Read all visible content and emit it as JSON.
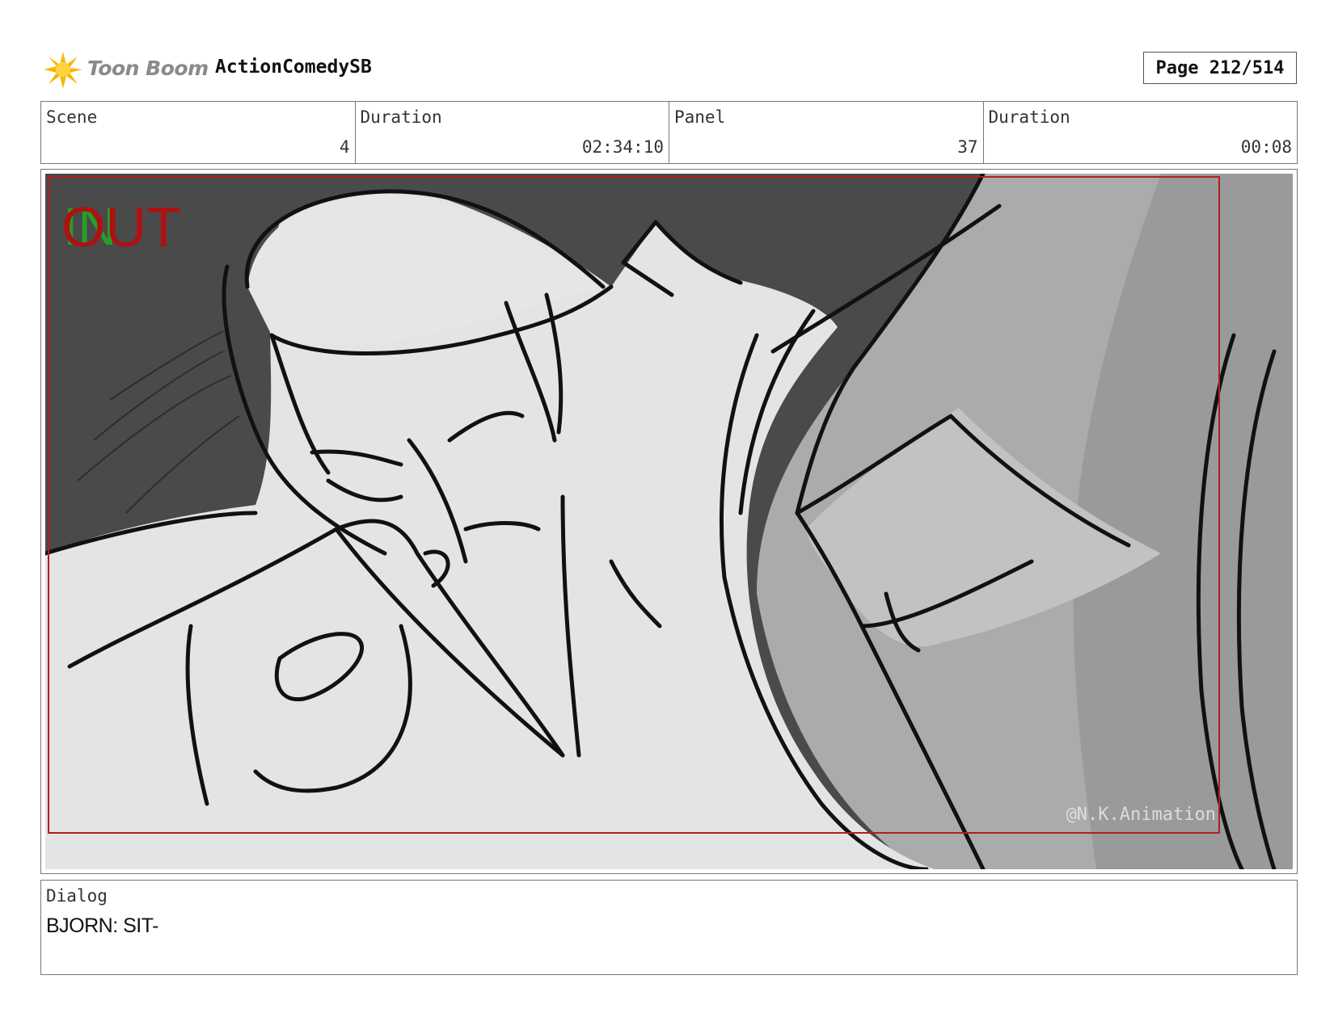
{
  "header": {
    "brand": "Toon Boom",
    "project": "ActionComedySB",
    "page": "Page 212/514"
  },
  "info": {
    "scene_label": "Scene",
    "scene_value": "4",
    "scene_duration_label": "Duration",
    "scene_duration_value": "02:34:10",
    "panel_label": "Panel",
    "panel_value": "37",
    "panel_duration_label": "Duration",
    "panel_duration_value": "00:08"
  },
  "panel": {
    "transition_marker": "OUT",
    "watermark": "@N.K.Animation"
  },
  "dialog": {
    "label": "Dialog",
    "text": "BJORN: SIT-"
  },
  "colors": {
    "marker_red": "#b01010",
    "marker_green": "#22aa22",
    "frame_red": "#b02020",
    "background_dark": "#4a4a4a",
    "figure_light": "#e4e4e4"
  }
}
